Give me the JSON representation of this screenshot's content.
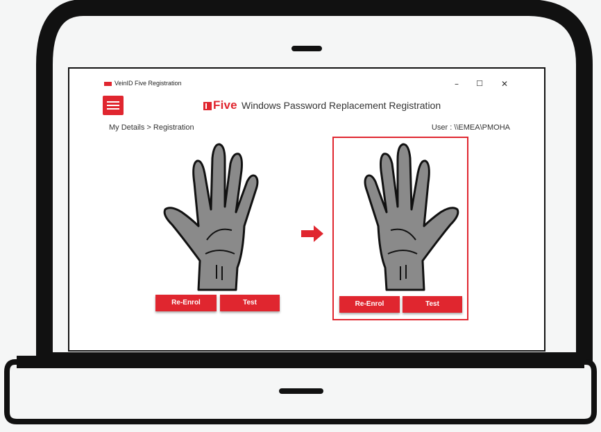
{
  "window": {
    "app_title": "VeinID Five Registration",
    "logo_text": "Five",
    "controls": {
      "minimize": "–",
      "maximize": "☐",
      "close": "✕"
    }
  },
  "header": {
    "brand": "Five",
    "title": "Windows Password Replacement Registration"
  },
  "breadcrumb": "My Details > Registration",
  "user": "User : \\\\EMEA\\PMOHA",
  "hands": {
    "left": {
      "re_enrol_label": "Re-Enrol",
      "test_label": "Test"
    },
    "right": {
      "re_enrol_label": "Re-Enrol",
      "test_label": "Test"
    }
  },
  "colors": {
    "accent": "#e0262f",
    "frame": "#111111",
    "hand_fill": "#888888"
  }
}
